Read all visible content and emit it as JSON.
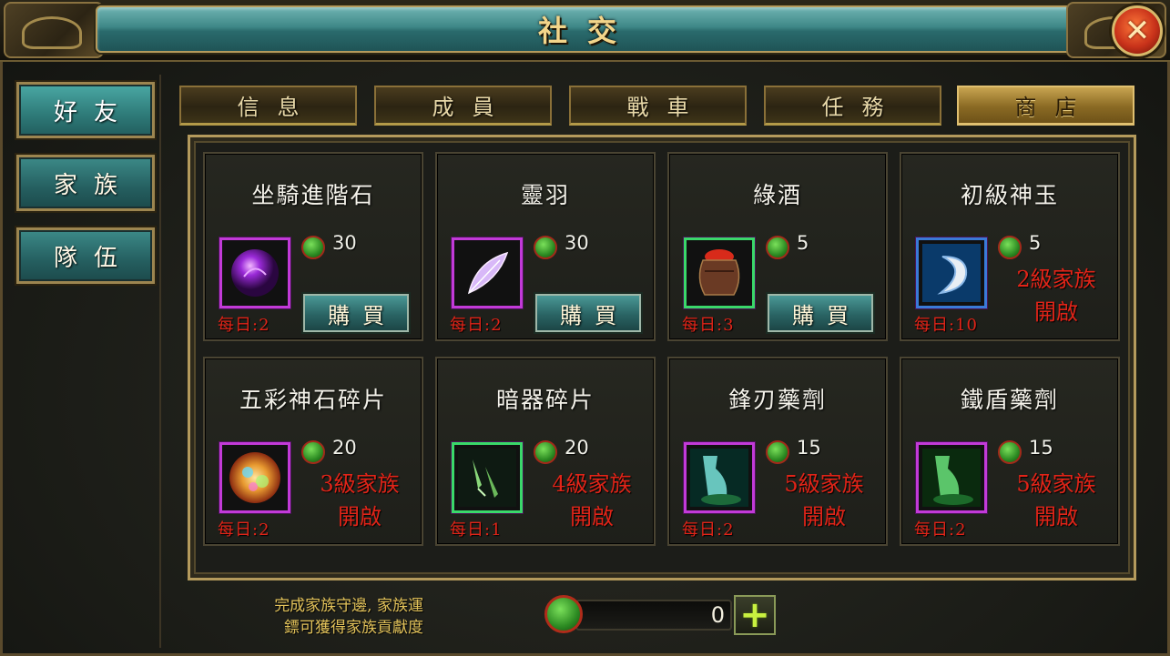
{
  "header": {
    "title": "社交",
    "close_icon": "✕"
  },
  "leftnav": {
    "items": [
      {
        "label": "好友",
        "active": true
      },
      {
        "label": "家族",
        "active": false
      },
      {
        "label": "隊伍",
        "active": false
      }
    ]
  },
  "tabs": [
    {
      "label": "信息",
      "active": false
    },
    {
      "label": "成員",
      "active": false
    },
    {
      "label": "戰車",
      "active": false
    },
    {
      "label": "任務",
      "active": false
    },
    {
      "label": "商店",
      "active": true
    }
  ],
  "shop": {
    "buy_label": "購買",
    "currency_icon": "jade-coin-icon",
    "items": [
      {
        "name": "坐騎進階石",
        "price": "30",
        "daily": "每日:2",
        "icon": "purple-orb-icon",
        "frame": "#c23ad8",
        "status": "buy",
        "lock_level": "",
        "lock_text": ""
      },
      {
        "name": "靈羽",
        "price": "30",
        "daily": "每日:2",
        "icon": "feather-icon",
        "frame": "#c23ad8",
        "status": "buy",
        "lock_level": "",
        "lock_text": ""
      },
      {
        "name": "綠酒",
        "price": "5",
        "daily": "每日:3",
        "icon": "wine-jar-icon",
        "frame": "#3ad86a",
        "status": "buy",
        "lock_level": "",
        "lock_text": ""
      },
      {
        "name": "初級神玉",
        "price": "5",
        "daily": "每日:10",
        "icon": "jade-tooth-icon",
        "frame": "#3a7ad8",
        "status": "locked",
        "lock_level": "2級家族",
        "lock_text": "開啟"
      },
      {
        "name": "五彩神石碎片",
        "price": "20",
        "daily": "每日:2",
        "icon": "rainbow-stone-icon",
        "frame": "#c23ad8",
        "status": "locked",
        "lock_level": "3級家族",
        "lock_text": "開啟"
      },
      {
        "name": "暗器碎片",
        "price": "20",
        "daily": "每日:1",
        "icon": "dart-icon",
        "frame": "#3ad86a",
        "status": "locked",
        "lock_level": "4級家族",
        "lock_text": "開啟"
      },
      {
        "name": "鋒刃藥劑",
        "price": "15",
        "daily": "每日:2",
        "icon": "potion-vial-icon",
        "frame": "#c23ad8",
        "status": "locked",
        "lock_level": "5級家族",
        "lock_text": "開啟"
      },
      {
        "name": "鐵盾藥劑",
        "price": "15",
        "daily": "每日:2",
        "icon": "potion-vial-green-icon",
        "frame": "#c23ad8",
        "status": "locked",
        "lock_level": "5級家族",
        "lock_text": "開啟"
      }
    ]
  },
  "footer": {
    "hint_line1": "完成家族守邊, 家族運",
    "hint_line2": "鏢可獲得家族貢獻度",
    "currency_value": "0",
    "plus_label": "+"
  }
}
